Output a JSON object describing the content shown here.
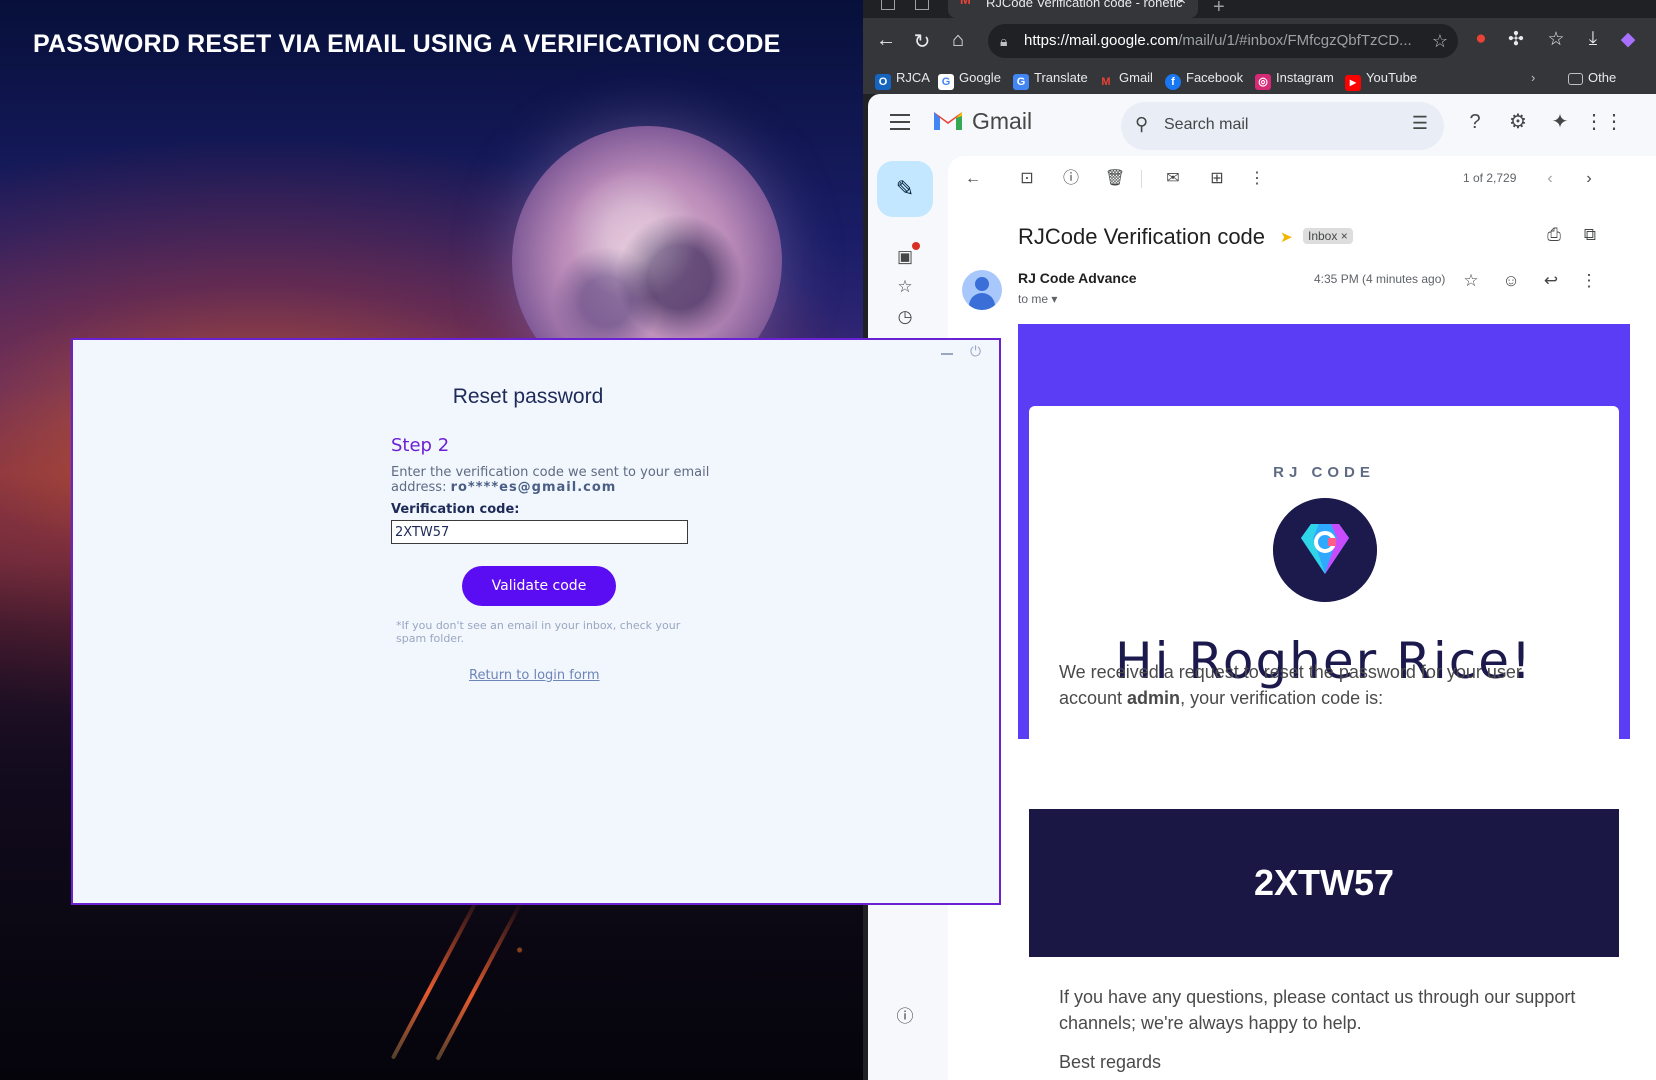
{
  "headline": "PASSWORD RESET VIA EMAIL USING A VERIFICATION CODE",
  "browser": {
    "tab_title": "RJCode Verification code - ronetic",
    "url_host": "https://mail.google.com",
    "url_rest": "/mail/u/1/#inbox/FMfcgzQbfTzCD...",
    "bookmarks": [
      "RJCA",
      "Google",
      "Translate",
      "Gmail",
      "Facebook",
      "Instagram",
      "YouTube"
    ],
    "other_bookmarks": "Othe"
  },
  "gmail": {
    "logo_text": "Gmail",
    "search_placeholder": "Search mail",
    "pager": "1 of 2,729",
    "subject": "RJCode Verification code",
    "label_chip": "Inbox ×",
    "sender": "RJ Code Advance",
    "to": "to me ▾",
    "time": "4:35 PM (4 minutes ago)",
    "email": {
      "brand": "RJ CODE",
      "greeting": "Hi Rogher Rice!",
      "para1_pre": "We received a request to reset the password for your user account ",
      "para1_user": "admin",
      "para1_post": ", your verification code is:",
      "code": "2XTW57",
      "para2": "If you have any questions, please contact us through our support channels; we're always happy to help.",
      "regards": "Best regards"
    }
  },
  "reset": {
    "title": "Reset password",
    "step": "Step 2",
    "description": "Enter the verification code we sent to your email address:",
    "masked_email": "ro****es@gmail.com",
    "code_label": "Verification code:",
    "code_value": "2XTW57",
    "validate_label": "Validate code",
    "note": "*If you don't see an email in your inbox, check your spam folder.",
    "return_link": "Return to login form"
  },
  "colors": {
    "accent_purple": "#5a0cf2",
    "email_band": "#5b3df5",
    "code_box": "#1a1745"
  }
}
